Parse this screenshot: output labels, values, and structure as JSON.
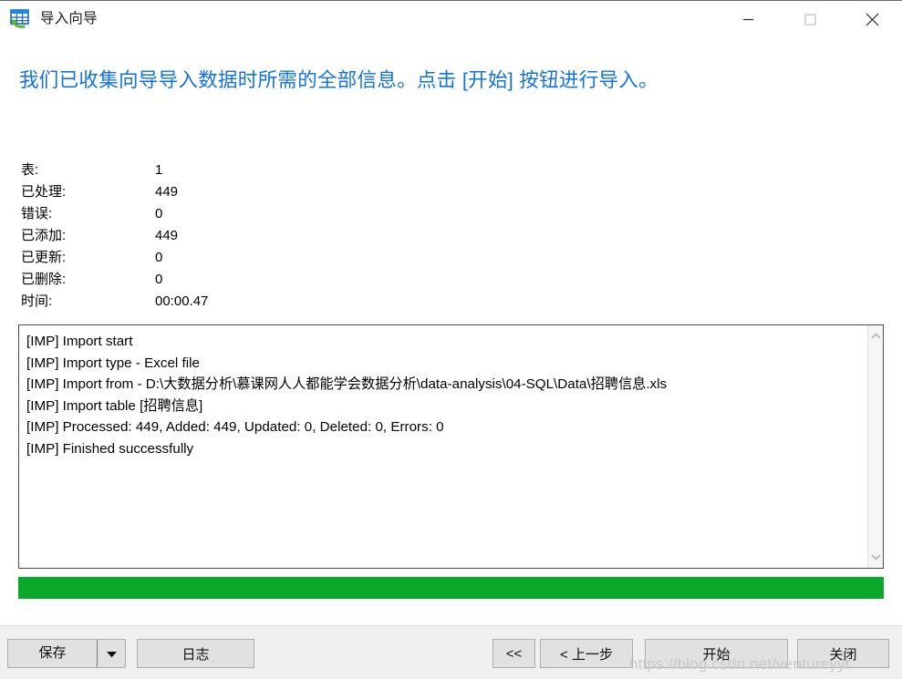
{
  "window": {
    "title": "导入向导",
    "icon": "import-table-icon",
    "controls": {
      "minimize": "minimize-icon",
      "maximize": "maximize-icon",
      "close": "close-icon"
    }
  },
  "headline": "我们已收集向导导入数据时所需的全部信息。点击 [开始] 按钮进行导入。",
  "stats": [
    {
      "label": "表:",
      "value": "1"
    },
    {
      "label": "已处理:",
      "value": "449"
    },
    {
      "label": "错误:",
      "value": "0"
    },
    {
      "label": "已添加:",
      "value": "449"
    },
    {
      "label": "已更新:",
      "value": "0"
    },
    {
      "label": "已删除:",
      "value": "0"
    },
    {
      "label": "时间:",
      "value": "00:00.47"
    }
  ],
  "log": {
    "lines": [
      "[IMP] Import start",
      "[IMP] Import type - Excel file",
      "[IMP] Import from - D:\\大数据分析\\慕课网人人都能学会数据分析\\data-analysis\\04-SQL\\Data\\招聘信息.xls",
      "[IMP] Import table [招聘信息]",
      "[IMP] Processed: 449, Added: 449, Updated: 0, Deleted: 0, Errors: 0",
      "[IMP] Finished successfully"
    ],
    "scrollbar": {
      "up_icon": "chevron-up-icon",
      "down_icon": "chevron-down-icon"
    }
  },
  "progress": {
    "percent": 100,
    "color": "#0aa92b"
  },
  "buttons": {
    "save": "保存",
    "save_dropdown_icon": "caret-down-icon",
    "log": "日志",
    "first": "<<",
    "prev": "< 上一步",
    "start": "开始",
    "close": "关闭"
  },
  "watermark": "https://blog.csdn.net/ventureyyt",
  "colors": {
    "headline": "#1273e0",
    "progress": "#0aa92b",
    "button_face": "#e1e1e1",
    "bottom_bar": "#f0f0f0"
  }
}
